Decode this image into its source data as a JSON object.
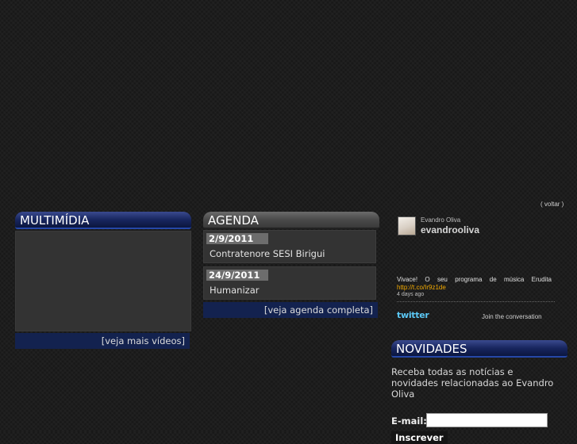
{
  "back_link": "( voltar )",
  "multimidia": {
    "title": "MULTIMÍDIA",
    "more_link": "[veja mais vídeos]"
  },
  "agenda": {
    "title": "AGENDA",
    "items": [
      {
        "date": "2/9/2011",
        "text": "Contratenore SESI Birigui"
      },
      {
        "date": "24/9/2011",
        "text": "Humanizar"
      }
    ],
    "more_link": "[veja agenda completa]"
  },
  "twitter": {
    "display_name": "Evandro Oliva",
    "handle": "evandrooliva",
    "tweet_text": "Vivace! O seu programa de música Erudita",
    "tweet_link": "http://t.co/Ir9z1de",
    "tweet_time": "4 days ago",
    "logo": "twitter",
    "join": "Join the conversation"
  },
  "novidades": {
    "title": "NOVIDADES",
    "description": "Receba todas as notícias e novidades relacionadas ao Evandro Oliva",
    "email_label": "E-mail:",
    "email_value": "",
    "subscribe_label": "Inscrever"
  },
  "colors": {
    "background": "#1d1d1d",
    "accent_blue": "#18265f",
    "link_bar": "#13224f",
    "tweet_link": "#f2a900"
  }
}
